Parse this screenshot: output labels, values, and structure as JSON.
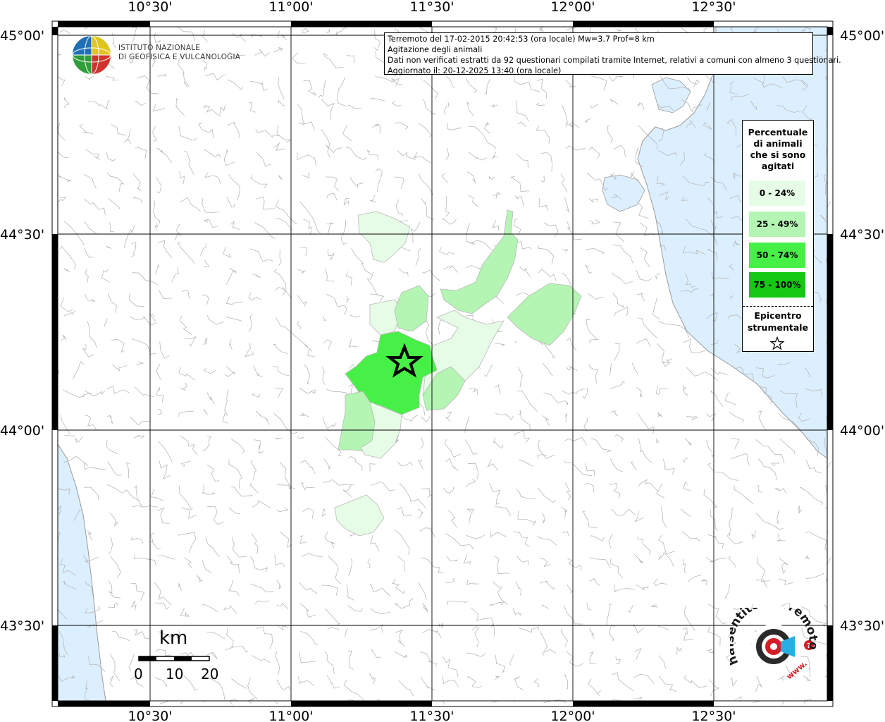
{
  "map": {
    "latitude_labels": [
      "45°00'",
      "44°30'",
      "44°00'",
      "43°30'"
    ],
    "longitude_labels": [
      "10°30'",
      "11°00'",
      "11°30'",
      "12°00'",
      "12°30'"
    ],
    "colors": {
      "sea": "#dcefff",
      "land": "#ffffff",
      "border": "#b4b4b4",
      "grid": "#000000",
      "class_0_24": "#e6fce6",
      "class_25_49": "#b4f5b4",
      "class_50_74": "#46f046",
      "class_75_100": "#14c814"
    },
    "epicenter_icon": "star-icon"
  },
  "info": {
    "line1": "Terremoto del 17-02-2015 20:42:53 (ora locale) Mw=3.7 Prof=8 km",
    "line2": "Agitazione degli animali",
    "line3": "Dati non verificati estratti da 92 questionari compilati tramite Internet, relativi a comuni con almeno 3 questionari.",
    "line4": "Aggiornato il: 20-12-2025 13:40 (ora locale)"
  },
  "legend": {
    "title_lines": [
      "Percentuale",
      "di animali",
      "che si sono",
      "agitati"
    ],
    "classes": [
      "0 - 24%",
      "25 - 49%",
      "50 - 74%",
      "75 - 100%"
    ],
    "epicenter_lines": [
      "Epicentro",
      "strumentale"
    ]
  },
  "logo": {
    "org_line1": "ISTITUTO NAZIONALE",
    "org_line2": "DI GEOFISICA E VULCANOLOGIA",
    "hst_text": "haisentitoilterremoto.it",
    "hst_url": "www."
  },
  "scale": {
    "unit": "km",
    "ticks": [
      "0",
      "10",
      "20"
    ]
  }
}
